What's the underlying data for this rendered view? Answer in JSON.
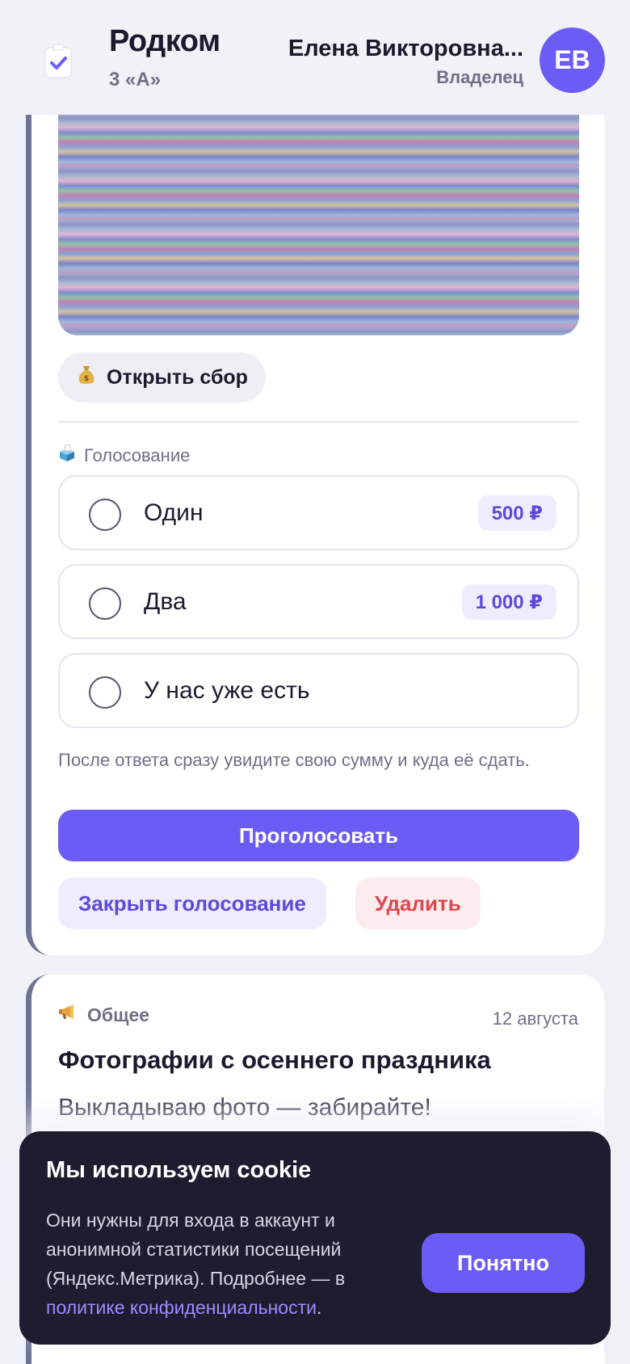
{
  "header": {
    "app_name": "Родком",
    "class_name": "3 «А»",
    "user_name": "Елена Викторовна...",
    "user_role": "Владелец",
    "avatar_initials": "ЕВ"
  },
  "fundraiser": {
    "open_label": "Открыть сбор",
    "icon": "money-bag"
  },
  "vote": {
    "section_label": "Голосование",
    "section_icon": "ballot-box",
    "options": [
      {
        "label": "Один",
        "amount": "500 ₽"
      },
      {
        "label": "Два",
        "amount": "1 000 ₽"
      },
      {
        "label": "У нас уже есть",
        "amount": ""
      }
    ],
    "hint": "После ответа сразу увидите свою сумму и куда её сдать.",
    "submit_label": "Проголосовать",
    "close_label": "Закрыть голосование",
    "delete_label": "Удалить"
  },
  "post": {
    "category": "Общее",
    "category_icon": "megaphone",
    "date": "12 августа",
    "title": "Фотографии с осеннего праздника",
    "text": "Выкладываю фото — забирайте!"
  },
  "cookie": {
    "title": "Мы используем cookie",
    "text_before": "Они нужны для входа в аккаунт и анонимной статистики посещений (Яндекс.Метрика). Подробнее — в ",
    "link_text": "политике конфиденциальности",
    "text_after": ".",
    "accept_label": "Понятно"
  },
  "colors": {
    "accent": "#6c5cf6",
    "danger": "#e0464f",
    "cookie_bg": "#1e1d2f"
  }
}
